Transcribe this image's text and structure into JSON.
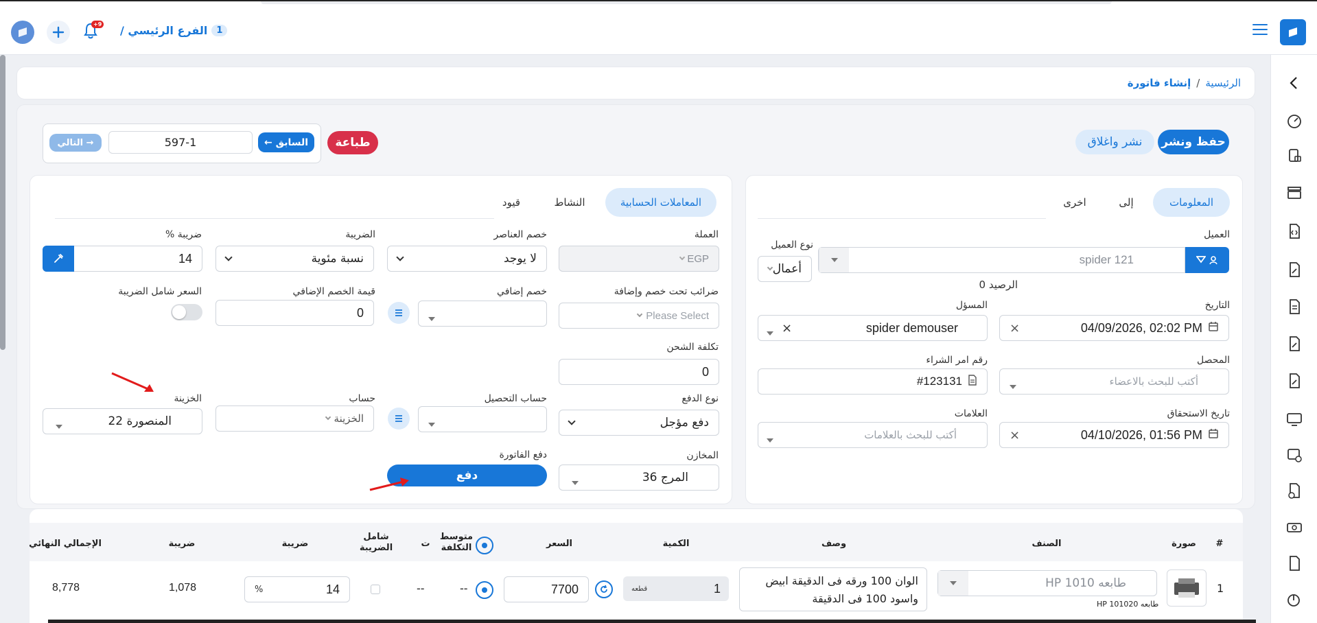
{
  "header": {
    "branch_label": "الفرع الرئيسي /",
    "branch_number": "1",
    "notification_badge": "+9"
  },
  "breadcrumb": {
    "home": "الرئيسية",
    "separator": "/",
    "current": "إنشاء فاتورة"
  },
  "toolbar": {
    "save_publish": "حفظ ونشر",
    "publish_close": "نشر واغلاق",
    "print": "طباعة",
    "previous": "← السابق",
    "invoice_number": "597-1",
    "next": "التالي →"
  },
  "left_tabs": {
    "info": "المعلومات",
    "to": "إلى",
    "other": "اخرى"
  },
  "right_tabs": {
    "accounting": "المعاملات الحسابية",
    "activity": "النشاط",
    "entries": "قيود"
  },
  "info": {
    "customer_label": "العميل",
    "customer_value": "spider 121",
    "customer_type_label": "نوع العميل",
    "customer_type_value": "أعمال",
    "balance": "الرصيد 0",
    "date_label": "التاريخ",
    "date_value": "04/09/2026, 02:02 PM",
    "responsible_label": "المسؤل",
    "responsible_value": "spider demouser",
    "collector_label": "المحصل",
    "collector_placeholder": "أكتب للبحث بالاعضاء",
    "po_label": "رقم امر الشراء",
    "po_value": "#123131",
    "due_label": "تاريخ الاستحقاق",
    "due_value": "04/10/2026, 01:56 PM",
    "tags_label": "العلامات",
    "tags_placeholder": "أكتب للبحث بالعلامات"
  },
  "accounting": {
    "currency_label": "العملة",
    "currency_value": "EGP",
    "item_discount_label": "خصم العناصر",
    "item_discount_value": "لا يوجد",
    "tax_label": "الضريبة",
    "tax_value": "نسبة مئوية",
    "tax_pct_label": "ضريبة %",
    "tax_pct_value": "14",
    "taxes_under_label": "ضرائب تحت خصم وإضافة",
    "taxes_under_placeholder": "Please Select",
    "extra_discount_label": "خصم إضافي",
    "extra_discount_value_label": "قيمة الخصم الإضافي",
    "extra_discount_value": "0",
    "price_incl_tax_label": "السعر شامل الضريبة",
    "shipping_label": "تكلفة الشحن",
    "shipping_value": "0",
    "payment_type_label": "نوع الدفع",
    "payment_type_value": "دفع مؤجل",
    "collection_account_label": "حساب التحصيل",
    "account_label": "حساب",
    "account_value": "الخزينة",
    "treasury_label": "الخزينة",
    "treasury_value": "المنصورة 22",
    "warehouses_label": "المخازن",
    "warehouses_value": "المرج 36",
    "pay_invoice_label": "دفع الفاتورة",
    "pay_button": "دفع"
  },
  "table": {
    "headers": {
      "num": "#",
      "image": "صورة",
      "item": "الصنف",
      "description": "وصف",
      "quantity": "الكمية",
      "price": "السعر",
      "avg_cost": "متوسط التكلفة",
      "t": "ت",
      "incl_tax": "شامل الضريبة",
      "tax": "ضريبة",
      "tax2": "ضريبة",
      "total": "الإجمالي النهائي"
    },
    "row": {
      "num": "1",
      "item_value": "طابعه HP 1010",
      "item_sub": "طابعه HP 101020",
      "description": "الوان 100 ورقه فى الدقيقة ابيض واسود 100 فى الدقيقة",
      "quantity": "1",
      "unit": "قطعه",
      "price": "7700",
      "avg_cost": "--",
      "t": "--",
      "tax_pct": "14",
      "pct_sign": "%",
      "tax_amount": "1,078",
      "total": "8,778"
    }
  }
}
